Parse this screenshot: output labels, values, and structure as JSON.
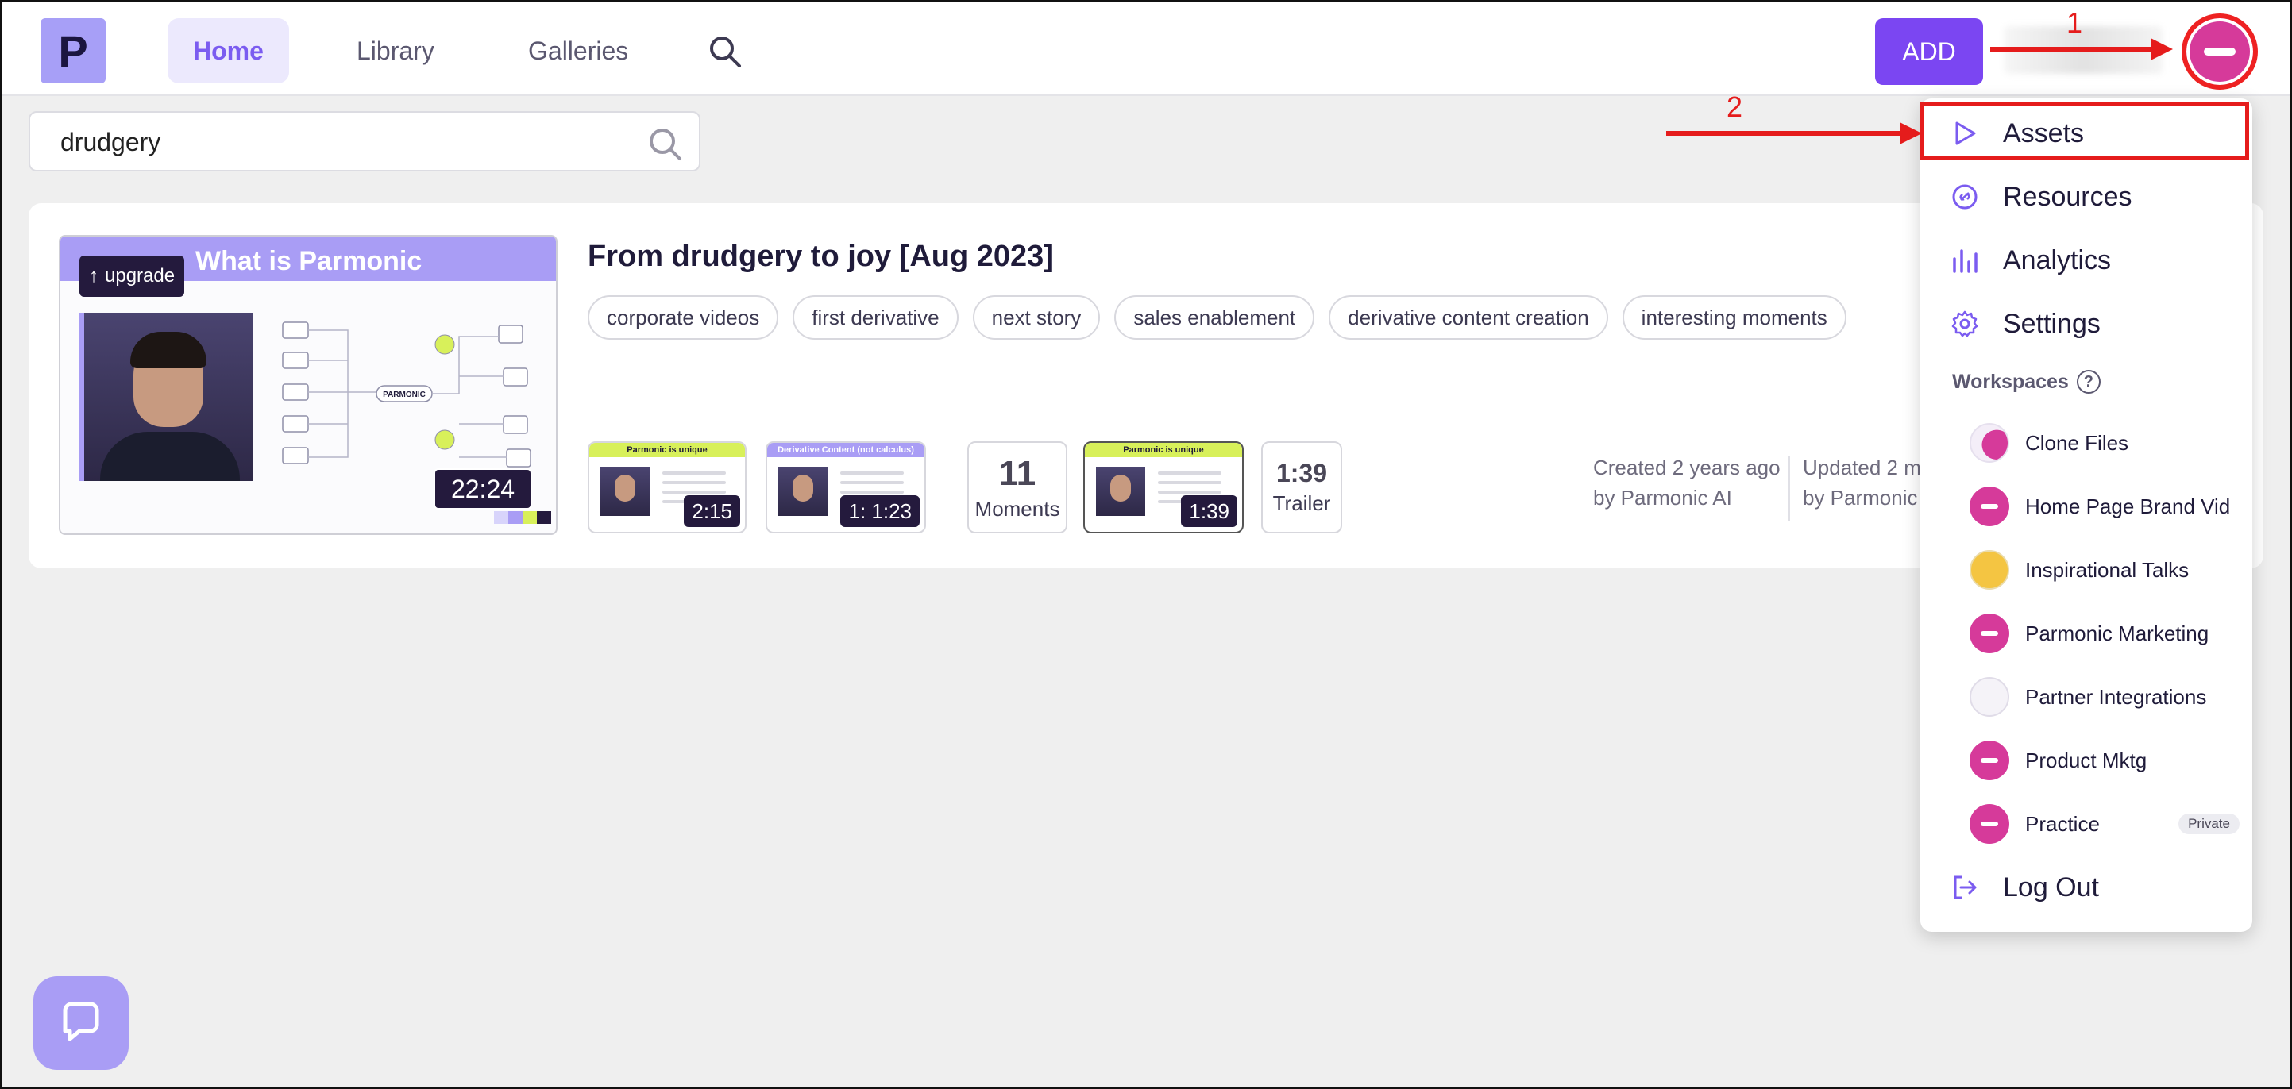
{
  "nav": {
    "logo_letter": "P",
    "items": [
      {
        "label": "Home",
        "active": true
      },
      {
        "label": "Library",
        "active": false
      },
      {
        "label": "Galleries",
        "active": false
      }
    ],
    "search_icon": "search-icon",
    "add_label": "ADD",
    "avatar_icon": "user-avatar"
  },
  "search": {
    "value": "drudgery",
    "icon": "search-icon"
  },
  "result": {
    "upgrade_label": "upgrade",
    "thumb_title": "What is Parmonic",
    "diagram_label": "PARMONIC",
    "duration": "22:24",
    "title": "From drudgery to joy [Aug 2023]",
    "tags": [
      "corporate videos",
      "first derivative",
      "next story",
      "sales enablement",
      "derivative content creation",
      "interesting moments"
    ],
    "derivatives": [
      {
        "band": "Parmonic is unique",
        "band_color": "#d8f05a",
        "duration": "2:15"
      },
      {
        "band": "Derivative Content (not calculus)",
        "band_color": "#a99df5",
        "duration": "1: 1:23"
      }
    ],
    "moments": {
      "count": "11",
      "label": "Moments"
    },
    "derivative_3": {
      "band": "Parmonic is unique",
      "band_color": "#d8f05a",
      "duration": "1:39"
    },
    "trailer": {
      "duration": "1:39",
      "label": "Trailer"
    },
    "created": {
      "line1": "Created 2 years ago",
      "line2": "by Parmonic AI"
    },
    "updated": {
      "line1": "Updated 2 m",
      "line2": "by Parmonic"
    }
  },
  "menu": {
    "items": [
      {
        "label": "Assets",
        "icon": "play-icon"
      },
      {
        "label": "Resources",
        "icon": "link-icon"
      },
      {
        "label": "Analytics",
        "icon": "bar-chart-icon"
      },
      {
        "label": "Settings",
        "icon": "gear-icon"
      }
    ],
    "workspaces_label": "Workspaces",
    "workspaces": [
      {
        "label": "Clone Files",
        "badge": ""
      },
      {
        "label": "Home Page Brand Vid",
        "badge": ""
      },
      {
        "label": "Inspirational Talks",
        "badge": ""
      },
      {
        "label": "Parmonic Marketing",
        "badge": ""
      },
      {
        "label": "Partner Integrations",
        "badge": ""
      },
      {
        "label": "Product Mktg",
        "badge": ""
      },
      {
        "label": "Practice",
        "badge": "Private"
      }
    ],
    "logout_label": "Log Out"
  },
  "annotations": {
    "step1": "1",
    "step2": "2",
    "color": "#e51c1c"
  },
  "colors": {
    "accent": "#7b46f2",
    "brand_light": "#a99df5",
    "avatar_pink": "#d63a9a"
  }
}
